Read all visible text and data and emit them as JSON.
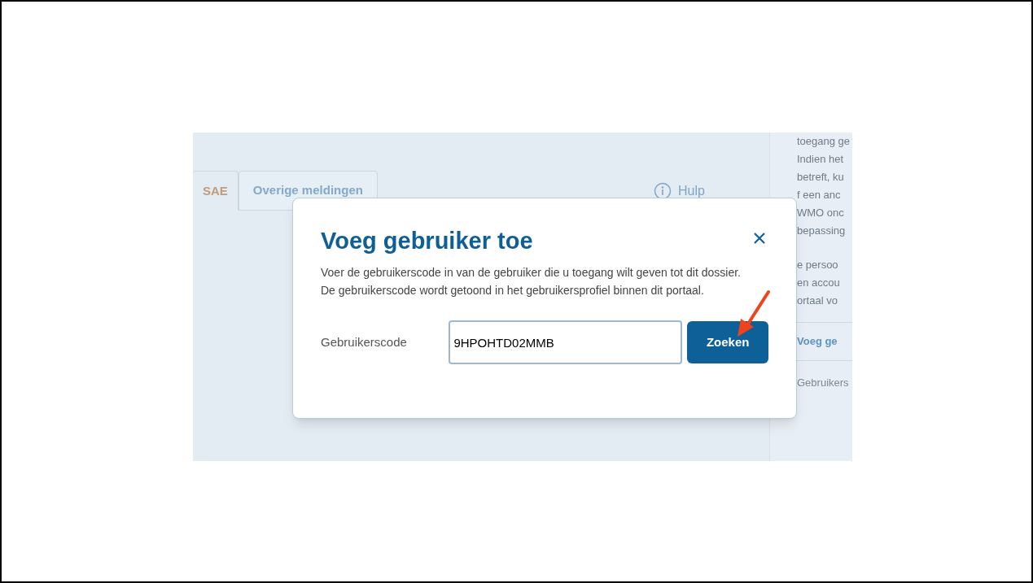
{
  "tabs": [
    {
      "label": "SAE",
      "selected": true
    },
    {
      "label": "Overige meldingen",
      "selected": false
    }
  ],
  "help_link": {
    "label": "Hulp"
  },
  "side_panel": {
    "lines": [
      "toegang ge",
      "Indien het",
      "betreft, ku",
      "f een anc",
      "WMO onc",
      "bepassing"
    ],
    "lines_2": [
      "e persoo",
      "en accou",
      "ortaal vo"
    ],
    "link": "Voeg ge",
    "footer": "Gebruikers"
  },
  "dialog": {
    "title": "Voeg gebruiker toe",
    "description": "Voer de gebruikerscode in van de gebruiker die u toegang wilt geven tot dit dossier. De gebruikerscode wordt getoond in het gebruikersprofiel binnen dit portaal.",
    "field_label": "Gebruikerscode",
    "field_value": "9HPOHTD02MMB",
    "button": "Zoeken"
  }
}
